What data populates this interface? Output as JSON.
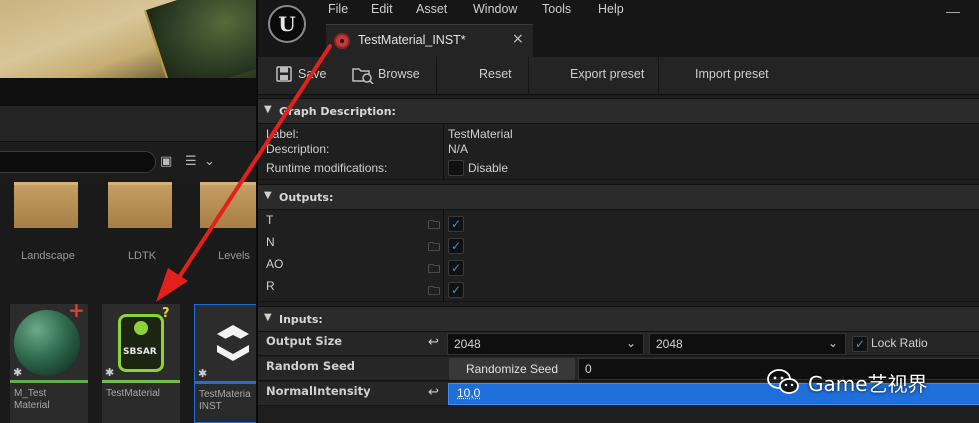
{
  "menu": [
    "File",
    "Edit",
    "Asset",
    "Window",
    "Tools",
    "Help"
  ],
  "tab": {
    "title": "TestMaterial_INST*",
    "close": "×"
  },
  "toolbar": {
    "save": "Save",
    "browse": "Browse",
    "reset": "Reset",
    "export_preset": "Export preset",
    "import_preset": "Import preset"
  },
  "graph_description": {
    "title": "Graph Description:",
    "label_key": "Label:",
    "label_value": "TestMaterial",
    "description_key": "Description:",
    "description_value": "N/A",
    "runtime_key": "Runtime modifications:",
    "runtime_value": "Disable",
    "runtime_checked": false
  },
  "outputs": {
    "title": "Outputs:",
    "items": [
      {
        "label": "T",
        "checked": true
      },
      {
        "label": "N",
        "checked": true
      },
      {
        "label": "AO",
        "checked": true
      },
      {
        "label": "R",
        "checked": true
      }
    ]
  },
  "inputs": {
    "title": "Inputs:",
    "output_size": {
      "label": "Output Size",
      "width": "2048",
      "height": "2048",
      "lock_ratio_label": "Lock Ratio",
      "lock_ratio_checked": true
    },
    "random_seed": {
      "label": "Random Seed",
      "button": "Randomize Seed",
      "value": "0"
    },
    "normal_intensity": {
      "label": "NormalIntensity",
      "value": "10,0",
      "progress_fraction": 1.0
    }
  },
  "content_browser": {
    "folders": [
      "Landscape",
      "LDTK",
      "Levels"
    ],
    "assets": [
      {
        "name_line1": "M_Test",
        "name_line2": "Material",
        "badge": "+"
      },
      {
        "name_line1": "TestMaterial",
        "name_line2": "",
        "badge": "?",
        "thumb_text": "SBSAR"
      },
      {
        "name_line1": "TestMateria",
        "name_line2": "INST",
        "badge": ""
      }
    ]
  },
  "watermark": "Game艺视界",
  "colors": {
    "accent_blue": "#1e6fd9",
    "arrow_red": "#e3201b",
    "sbsar_green": "#8bd33b"
  }
}
